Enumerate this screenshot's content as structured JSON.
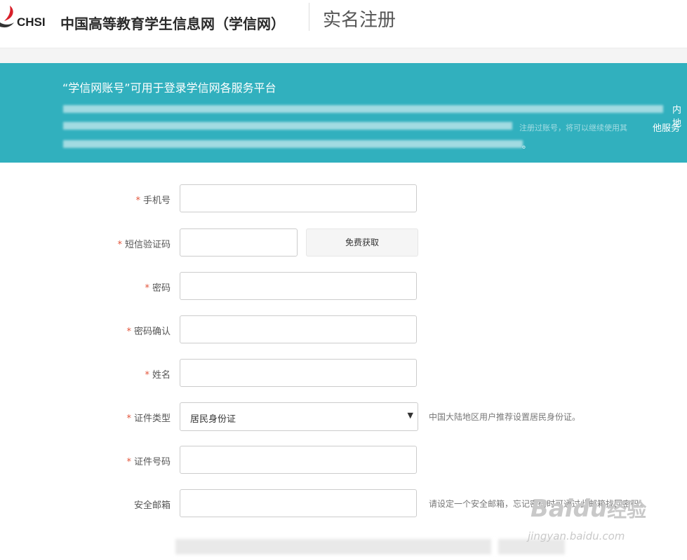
{
  "header": {
    "logo_text": "CHSI",
    "site_name": "中国高等教育学生信息网（学信网）",
    "page_title": "实名注册"
  },
  "banner": {
    "title": "“学信网账号”可用于登录学信网各服务平台",
    "line1_end": "内地",
    "line2_end": "他服务",
    "line2_faint": "注册过账号，将可以继续使用其",
    "line3_end": "。"
  },
  "form": {
    "required_mark": "*",
    "phone": {
      "label": "手机号"
    },
    "sms": {
      "label": "短信验证码",
      "button": "免费获取"
    },
    "password": {
      "label": "密码"
    },
    "password_confirm": {
      "label": "密码确认"
    },
    "name": {
      "label": "姓名"
    },
    "id_type": {
      "label": "证件类型",
      "selected": "居民身份证",
      "arrow": "▼",
      "hint": "中国大陆地区用户推荐设置居民身份证。"
    },
    "id_number": {
      "label": "证件号码"
    },
    "email": {
      "label": "安全邮箱",
      "hint": "请设定一个安全邮箱，忘记密码时可通过此邮箱找回密码。"
    }
  },
  "watermark": {
    "brand": "Baidu",
    "suffix": "经验",
    "url": "jingyan.baidu.com"
  },
  "colors": {
    "banner": "#31b0be",
    "required": "#e3553b",
    "logo": "#d8202a"
  }
}
